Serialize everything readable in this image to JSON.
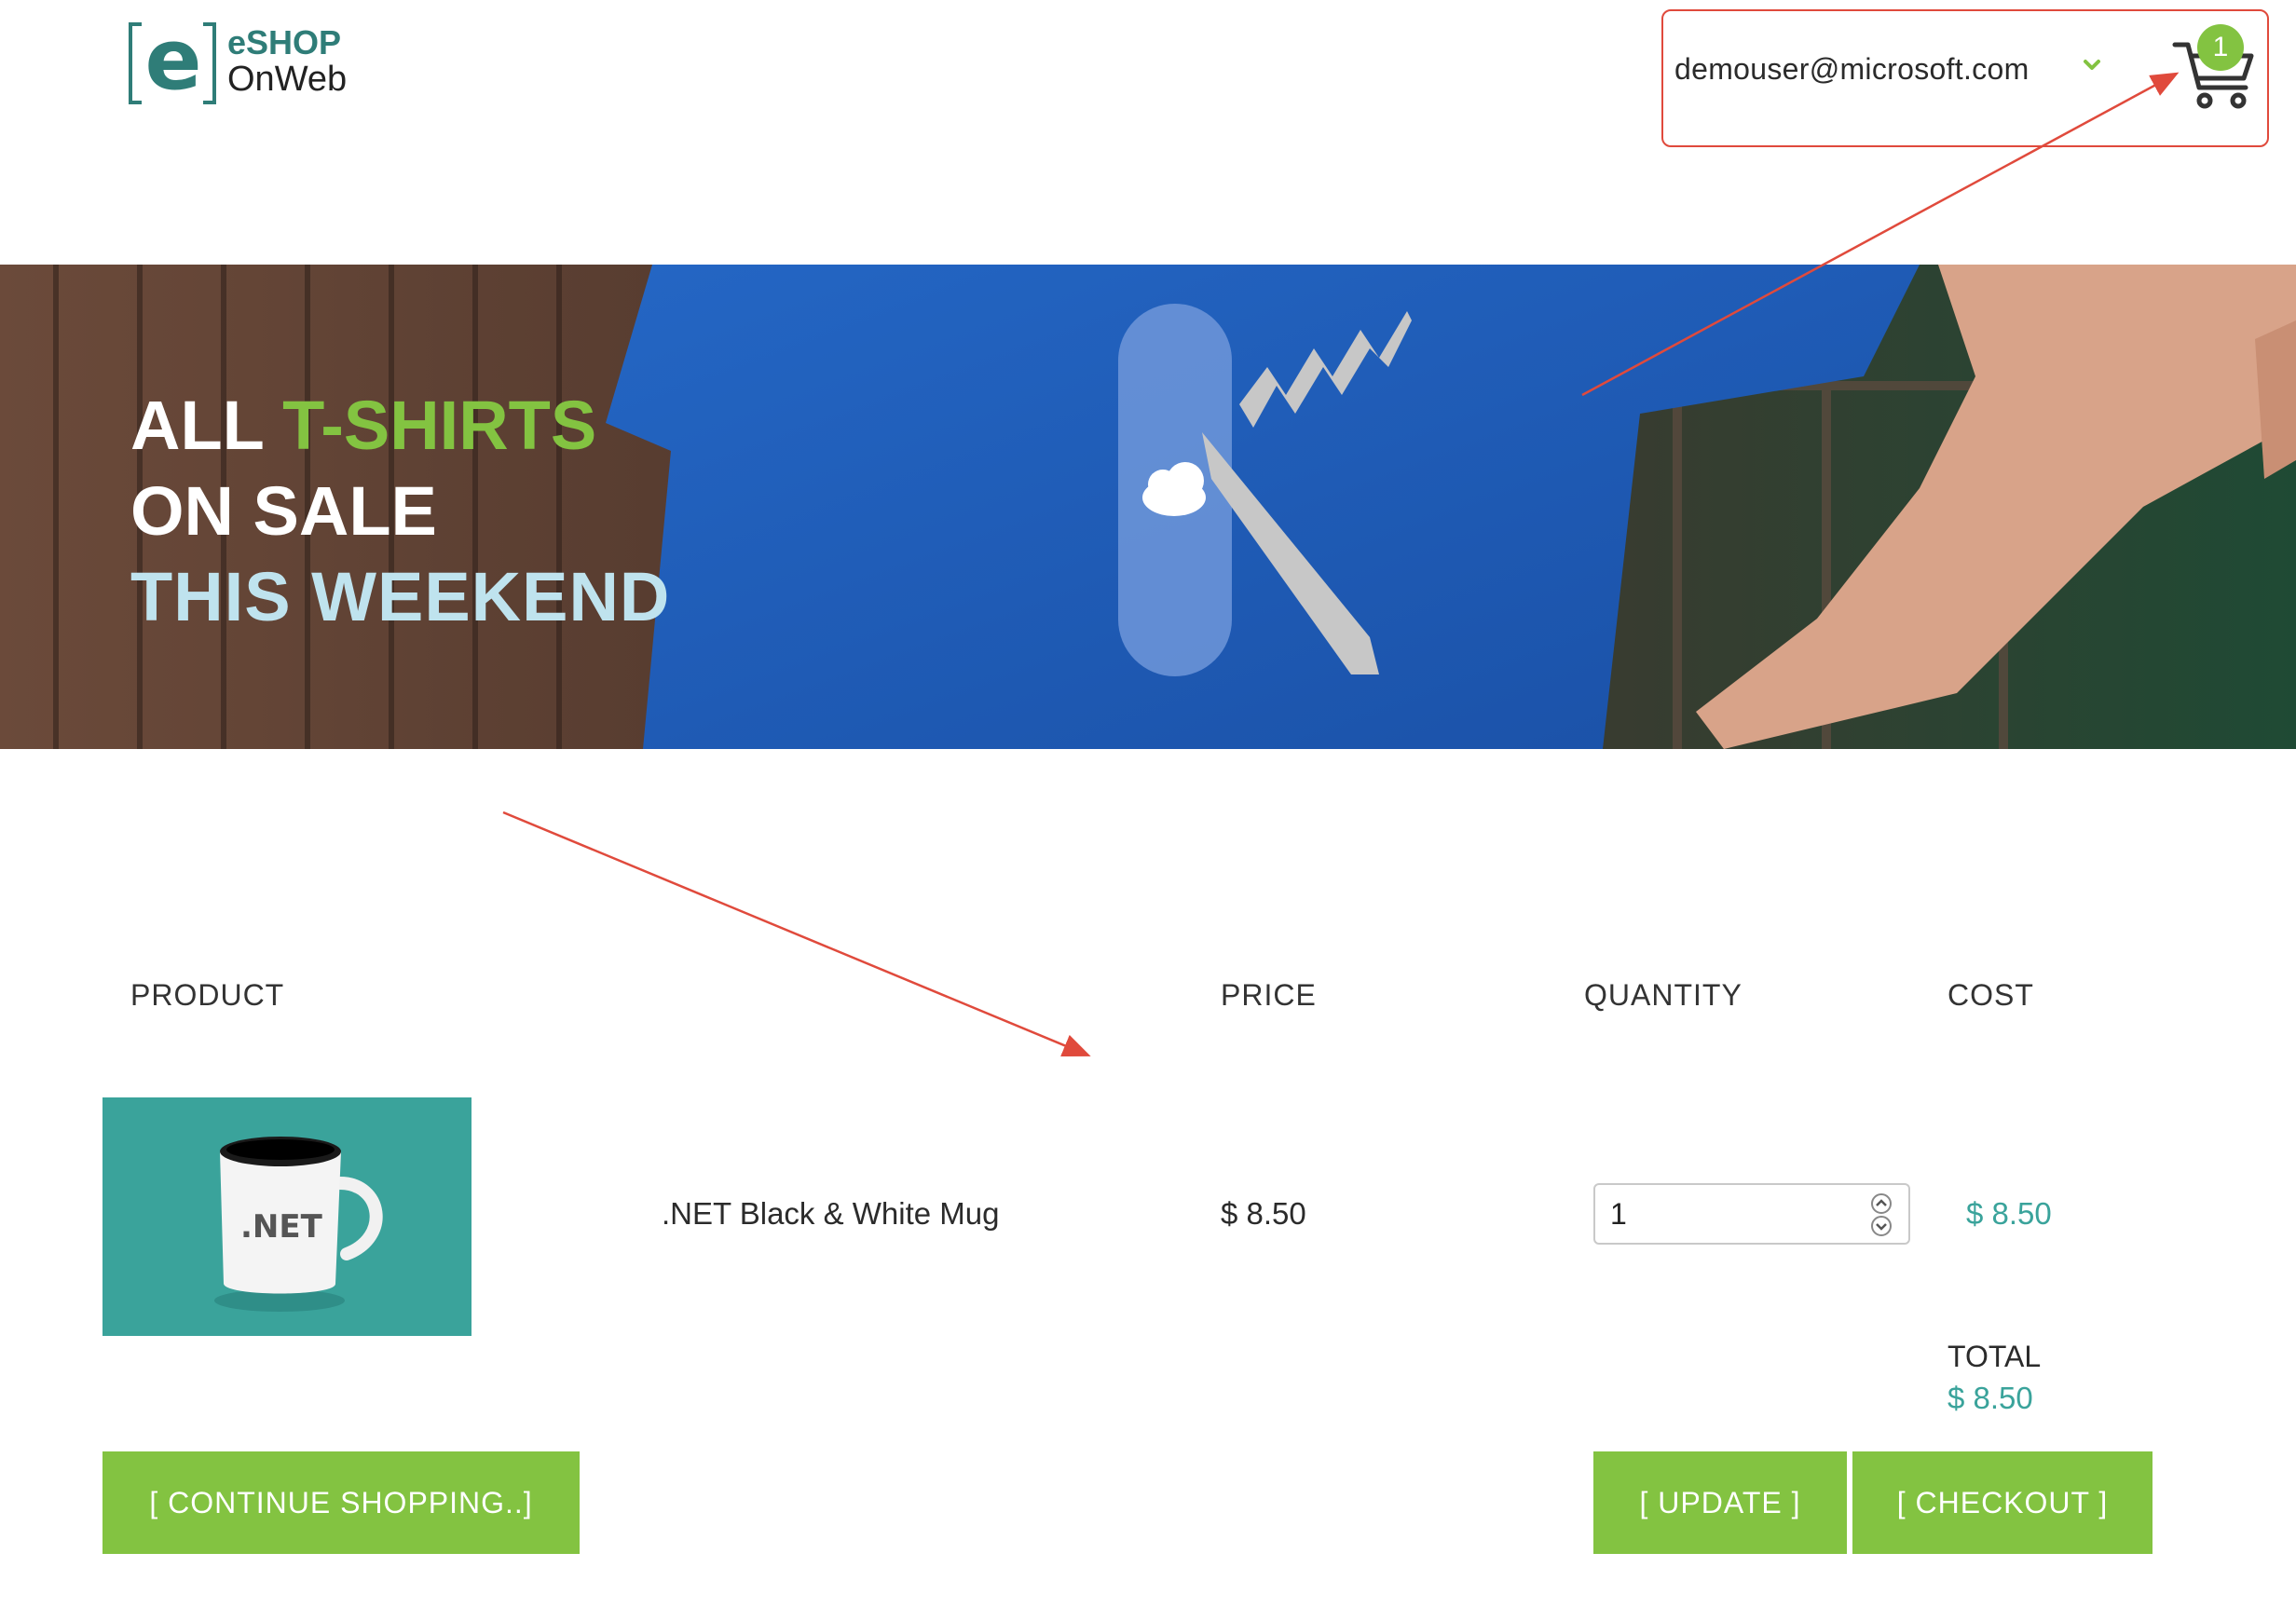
{
  "header": {
    "logo": {
      "line1": "eSHOP",
      "line2": "OnWeb",
      "mark": "e"
    },
    "user": {
      "email": "demouser@microsoft.com",
      "chevron_icon": "chevron-down-icon"
    },
    "cart": {
      "icon": "shopping-cart-icon",
      "count": "1"
    }
  },
  "hero": {
    "line1_plain": "ALL",
    "line1_accent": "T-SHIRTS",
    "line2": "ON SALE",
    "line3": "THIS WEEKEND"
  },
  "cart_table": {
    "columns": {
      "product": "PRODUCT",
      "price": "PRICE",
      "quantity": "QUANTITY",
      "cost": "COST"
    },
    "items": [
      {
        "image_label": ".NET",
        "name": ".NET Black & White Mug",
        "price": "$ 8.50",
        "quantity": "1",
        "cost": "$ 8.50"
      }
    ],
    "total": {
      "label": "TOTAL",
      "value": "$ 8.50"
    }
  },
  "actions": {
    "continue_label": "[ CONTINUE SHOPPING..]",
    "update_label": "[ UPDATE ]",
    "checkout_label": "[ CHECKOUT ]"
  },
  "colors": {
    "brand_teal": "#2f7d78",
    "accent_green": "#83c341",
    "price_teal": "#3aa39b",
    "annotation_red": "#e04a3c",
    "shirt_blue": "#1d5db8"
  }
}
